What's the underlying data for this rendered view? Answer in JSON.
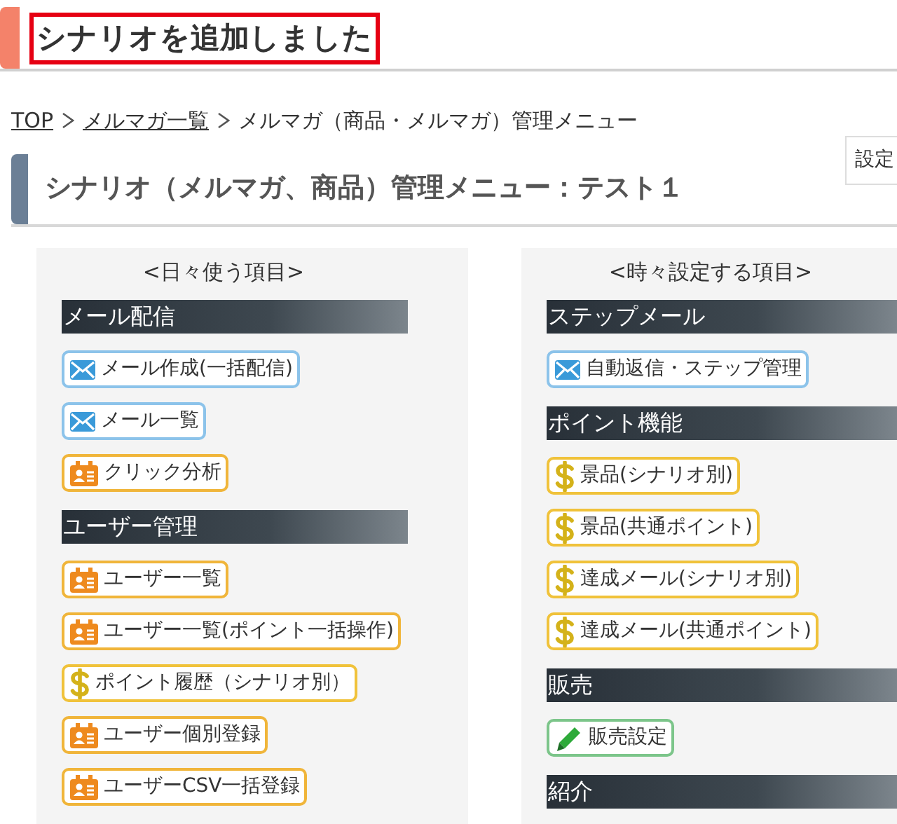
{
  "banner": {
    "title": "シナリオを追加しました"
  },
  "breadcrumb": [
    {
      "label": "TOP",
      "link": true
    },
    {
      "label": "メルマガ一覧",
      "link": true
    },
    {
      "label": "メルマガ（商品・メルマガ）管理メニュー",
      "link": false
    }
  ],
  "settings_button": {
    "label": "設定"
  },
  "heading": "シナリオ（メルマガ、商品）管理メニュー：テスト１",
  "columns": [
    {
      "title": "<日々使う項目>",
      "sections": [
        {
          "title": "メール配信",
          "items": [
            {
              "label": "メール作成(一括配信)",
              "kind": "mail"
            },
            {
              "label": "メール一覧",
              "kind": "mail"
            },
            {
              "label": "クリック分析",
              "kind": "user"
            }
          ]
        },
        {
          "title": "ユーザー管理",
          "items": [
            {
              "label": "ユーザー一覧",
              "kind": "user"
            },
            {
              "label": "ユーザー一覧(ポイント一括操作)",
              "kind": "user"
            },
            {
              "label": "ポイント履歴（シナリオ別）",
              "kind": "point"
            },
            {
              "label": "ユーザー個別登録",
              "kind": "user"
            },
            {
              "label": "ユーザーCSV一括登録",
              "kind": "user"
            }
          ]
        }
      ]
    },
    {
      "title": "<時々設定する項目>",
      "sections": [
        {
          "title": "ステップメール",
          "items": [
            {
              "label": "自動返信・ステップ管理",
              "kind": "mail"
            }
          ]
        },
        {
          "title": "ポイント機能",
          "items": [
            {
              "label": "景品(シナリオ別)",
              "kind": "point"
            },
            {
              "label": "景品(共通ポイント)",
              "kind": "point"
            },
            {
              "label": "達成メール(シナリオ別)",
              "kind": "point"
            },
            {
              "label": "達成メール(共通ポイント)",
              "kind": "point"
            }
          ]
        },
        {
          "title": "販売",
          "items": [
            {
              "label": "販売設定",
              "kind": "pen"
            }
          ]
        },
        {
          "title": "紹介"
        }
      ]
    }
  ]
}
